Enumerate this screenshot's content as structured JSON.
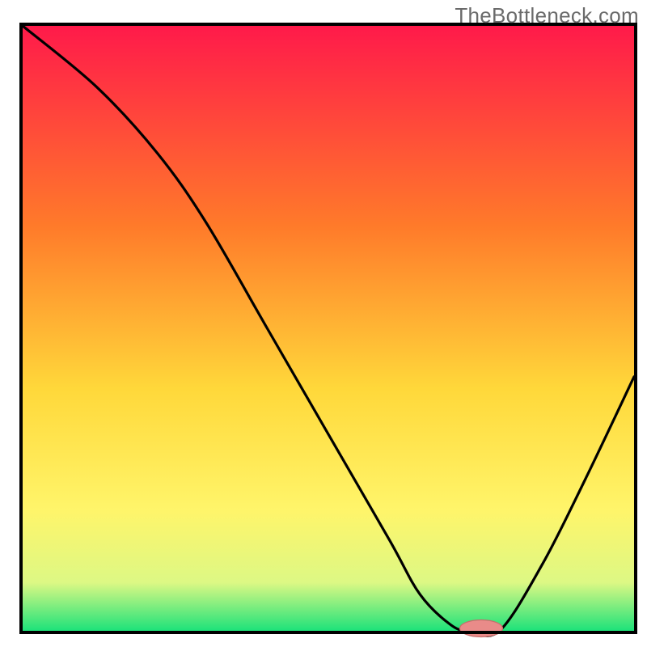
{
  "watermark": "TheBottleneck.com",
  "colors": {
    "frame": "#000000",
    "curve": "#000000",
    "marker_fill": "#e98b89",
    "marker_stroke": "#c66e6c",
    "grad_top": "#ff1a4a",
    "grad_mid1": "#ff7a2a",
    "grad_mid2": "#ffd83a",
    "grad_mid3": "#fff56a",
    "grad_mid4": "#ddf884",
    "grad_bottom": "#1de27a"
  },
  "chart_data": {
    "type": "line",
    "title": "",
    "xlabel": "",
    "ylabel": "",
    "xlim": [
      0,
      100
    ],
    "ylim": [
      0,
      100
    ],
    "series": [
      {
        "name": "bottleneck-curve",
        "x": [
          0,
          12,
          22,
          30,
          40,
          50,
          60,
          65,
          70,
          73,
          78,
          85,
          92,
          100
        ],
        "values": [
          100,
          90,
          79,
          67.5,
          50,
          32.5,
          15,
          6,
          1,
          0,
          0,
          11,
          25,
          42
        ]
      }
    ],
    "marker": {
      "x": 75,
      "y": 0,
      "rx": 3.5,
      "ry": 1.4
    },
    "annotations": []
  }
}
